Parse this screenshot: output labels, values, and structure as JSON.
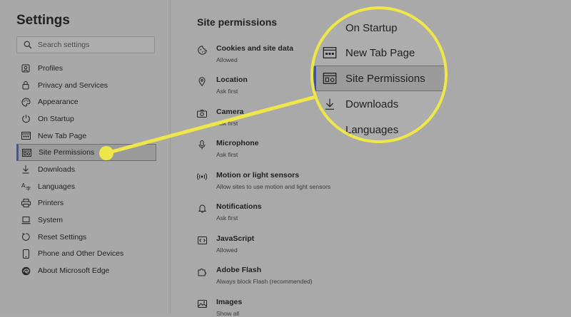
{
  "sidebar": {
    "title": "Settings",
    "search_placeholder": "Search settings",
    "items": [
      {
        "label": "Profiles",
        "icon": "profile-icon"
      },
      {
        "label": "Privacy and Services",
        "icon": "lock-icon"
      },
      {
        "label": "Appearance",
        "icon": "palette-icon"
      },
      {
        "label": "On Startup",
        "icon": "power-icon"
      },
      {
        "label": "New Tab Page",
        "icon": "new-tab-icon"
      },
      {
        "label": "Site Permissions",
        "icon": "site-permissions-icon",
        "active": true
      },
      {
        "label": "Downloads",
        "icon": "download-icon"
      },
      {
        "label": "Languages",
        "icon": "languages-icon"
      },
      {
        "label": "Printers",
        "icon": "printer-icon"
      },
      {
        "label": "System",
        "icon": "laptop-icon"
      },
      {
        "label": "Reset Settings",
        "icon": "reset-icon"
      },
      {
        "label": "Phone and Other Devices",
        "icon": "phone-icon"
      },
      {
        "label": "About Microsoft Edge",
        "icon": "edge-icon"
      }
    ]
  },
  "main": {
    "title": "Site permissions",
    "permissions": [
      {
        "title": "Cookies and site data",
        "subtitle": "Allowed",
        "icon": "cookie-icon"
      },
      {
        "title": "Location",
        "subtitle": "Ask first",
        "icon": "location-pin-icon"
      },
      {
        "title": "Camera",
        "subtitle": "Ask first",
        "icon": "camera-icon"
      },
      {
        "title": "Microphone",
        "subtitle": "Ask first",
        "icon": "microphone-icon"
      },
      {
        "title": "Motion or light sensors",
        "subtitle": "Allow sites to use motion and light sensors",
        "icon": "sensor-icon"
      },
      {
        "title": "Notifications",
        "subtitle": "Ask first",
        "icon": "bell-icon"
      },
      {
        "title": "JavaScript",
        "subtitle": "Allowed",
        "icon": "code-icon"
      },
      {
        "title": "Adobe Flash",
        "subtitle": "Always block Flash (recommended)",
        "icon": "puzzle-icon"
      },
      {
        "title": "Images",
        "subtitle": "Show all",
        "icon": "image-icon"
      }
    ]
  },
  "zoom_callout": {
    "items": [
      {
        "label": "On Startup"
      },
      {
        "label": "New Tab Page",
        "icon": "new-tab-icon"
      },
      {
        "label": "Site Permissions",
        "icon": "site-permissions-icon",
        "active": true
      },
      {
        "label": "Downloads",
        "icon": "download-icon"
      },
      {
        "label": "Languages"
      }
    ]
  },
  "colors": {
    "background": "#a9a9a9",
    "highlight_yellow": "#efe64a",
    "active_accent": "#3f55a5"
  }
}
